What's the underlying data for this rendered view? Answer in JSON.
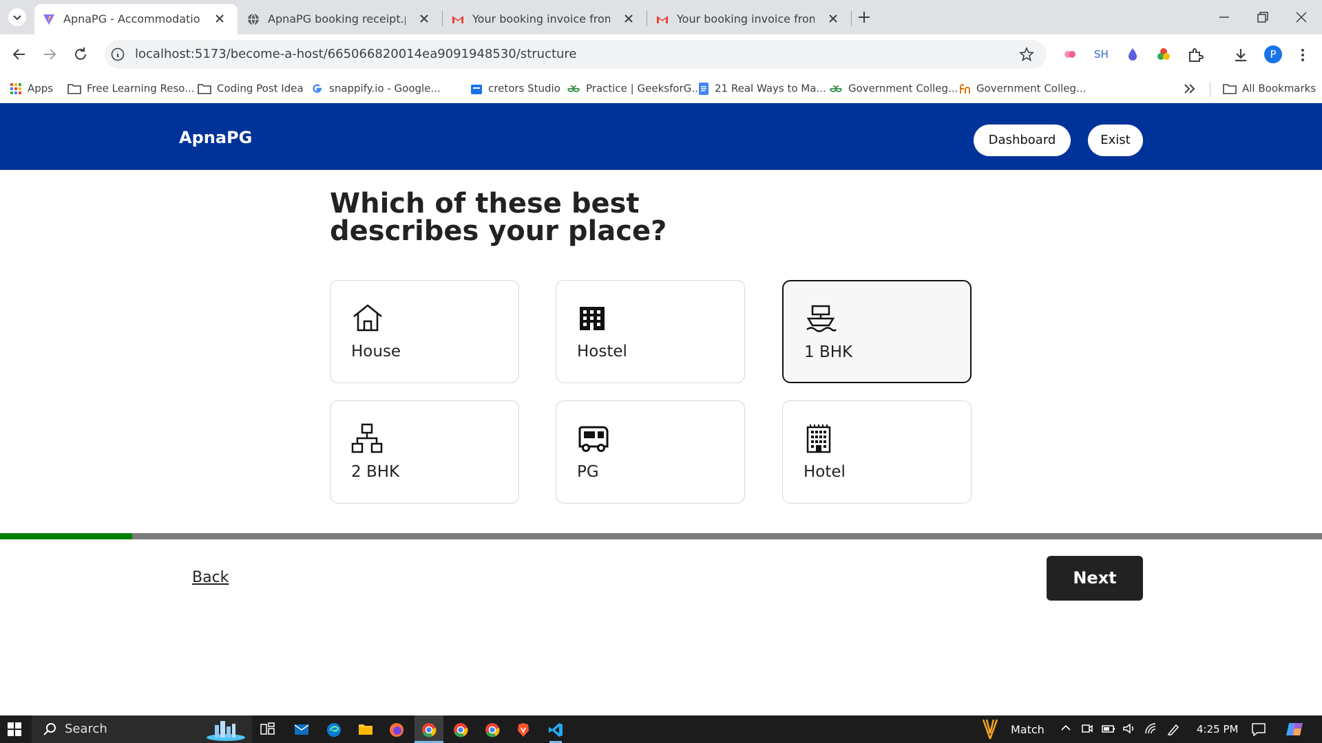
{
  "browser": {
    "tabs": [
      {
        "title": "ApnaPG - Accommodation Solu",
        "icon": "vite-icon",
        "active": true
      },
      {
        "title": "ApnaPG booking receipt.pdf",
        "icon": "globe-icon",
        "active": false
      },
      {
        "title": "Your booking invoice from Apn",
        "icon": "gmail-icon",
        "active": false
      },
      {
        "title": "Your booking invoice from Apn",
        "icon": "gmail-icon",
        "active": false
      }
    ],
    "url": "localhost:5173/become-a-host/665066820014ea9091948530/structure",
    "extension_sh": "SH",
    "profile_initial": "P",
    "bookmarks": [
      {
        "label": "Apps",
        "icon": "apps-grid-icon"
      },
      {
        "label": "Free Learning Reso...",
        "icon": "folder-icon"
      },
      {
        "label": "Coding Post Idea",
        "icon": "folder-icon"
      },
      {
        "label": "snappify.io - Google...",
        "icon": "google-icon"
      },
      {
        "label": "cretors Studio",
        "icon": "studio-icon"
      },
      {
        "label": "Practice | GeeksforG...",
        "icon": "geeksforgeeks-icon"
      },
      {
        "label": "21 Real Ways to Ma...",
        "icon": "docs-icon"
      },
      {
        "label": "Government Colleg...",
        "icon": "geeksforgeeks-icon"
      },
      {
        "label": "Government Colleg...",
        "icon": "fn-icon"
      }
    ],
    "all_bookmarks": "All Bookmarks"
  },
  "app": {
    "logo": "ApnaPG",
    "dashboard_label": "Dashboard",
    "exit_label": "Exist",
    "brand_color": "#003399",
    "heading": "Which of these best describes your place?",
    "options": [
      {
        "label": "House",
        "icon": "house-icon",
        "selected": false
      },
      {
        "label": "Hostel",
        "icon": "building-icon",
        "selected": false
      },
      {
        "label": "1 BHK",
        "icon": "ship-icon",
        "selected": true
      },
      {
        "label": "2 BHK",
        "icon": "network-icon",
        "selected": false
      },
      {
        "label": "PG",
        "icon": "rv-icon",
        "selected": false
      },
      {
        "label": "Hotel",
        "icon": "hotel-icon",
        "selected": false
      }
    ],
    "progress_fraction": 0.1,
    "progress_color": "#008000",
    "back_label": "Back",
    "next_label": "Next"
  },
  "taskbar": {
    "search_label": "Search",
    "weather_label": "Match",
    "time": "4:25 PM"
  }
}
